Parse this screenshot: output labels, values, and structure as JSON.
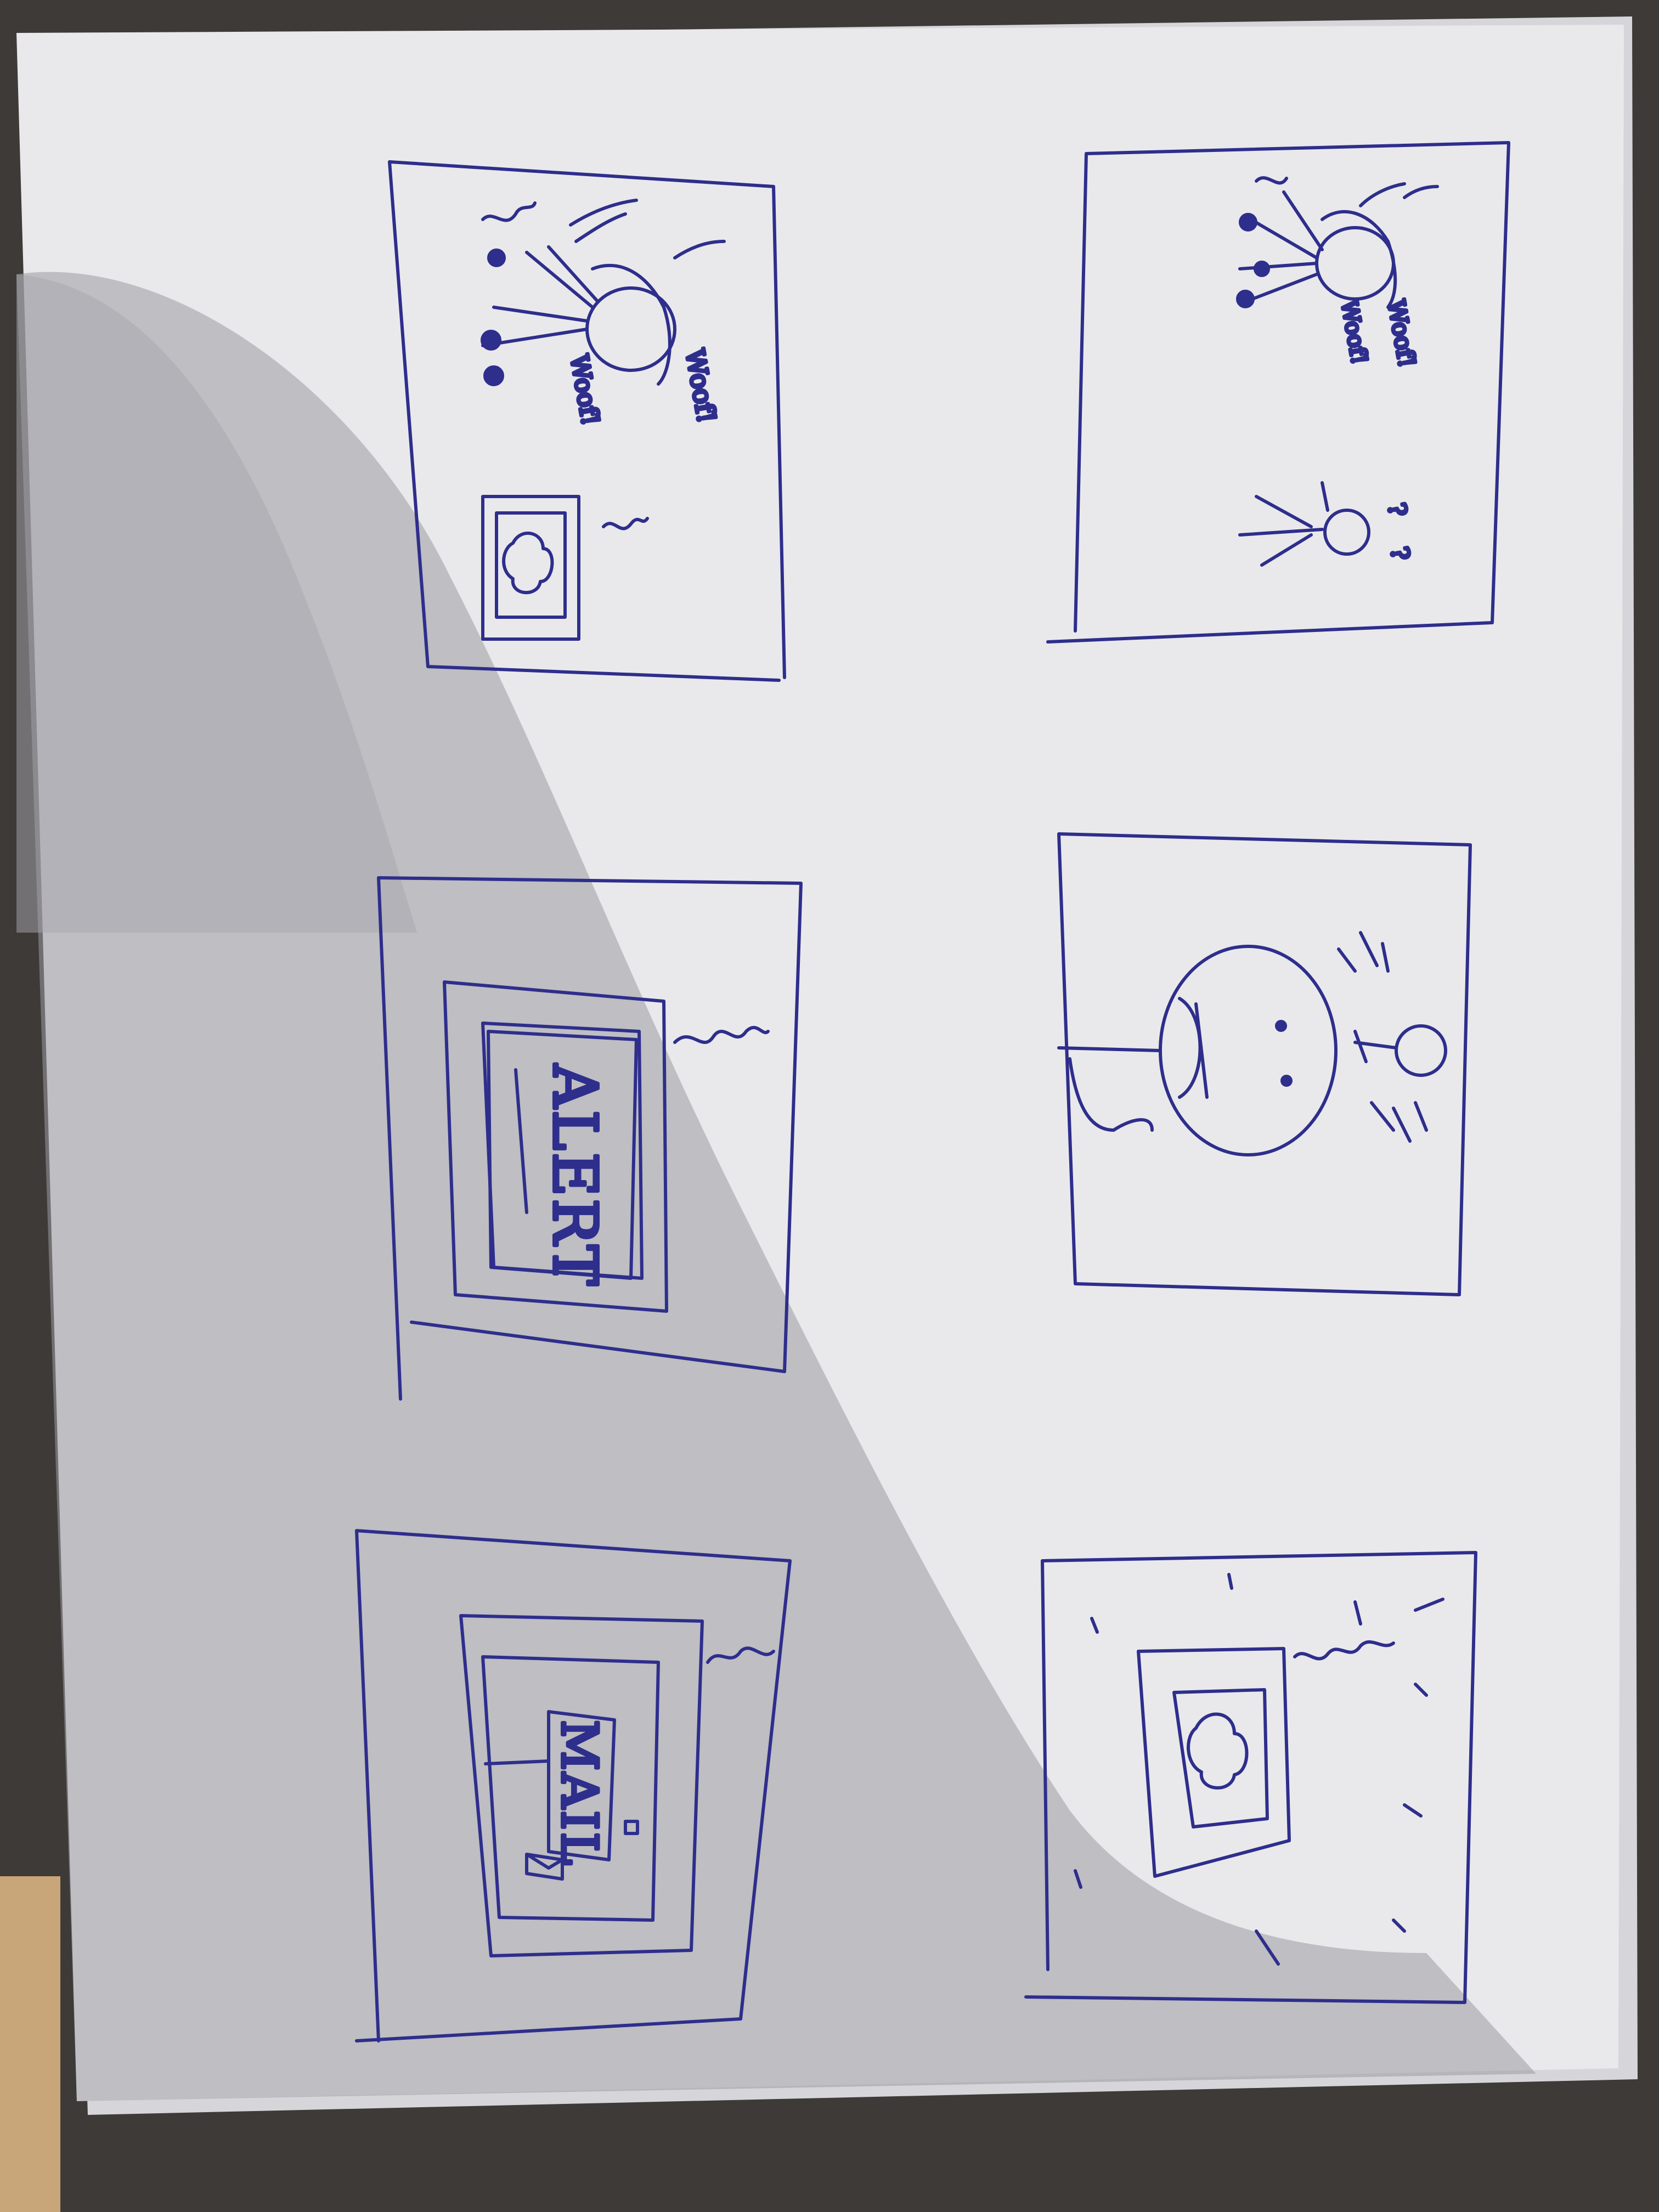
{
  "photo": {
    "colors": {
      "table": "#3e3a37",
      "table_wood": "#c9a57a",
      "paper": "#e9e9ec",
      "paper_back": "#d6d6da",
      "shadow": "#9a9aa3",
      "ink": "#2e2e8c"
    }
  },
  "panels": [
    {
      "id": "panel-1",
      "words": [
        "Woof!",
        "Woof!"
      ]
    },
    {
      "id": "panel-2",
      "words": [
        "Woof!",
        "Woof!",
        "?",
        "?"
      ]
    },
    {
      "id": "panel-3",
      "words": [
        "ALERT"
      ]
    },
    {
      "id": "panel-4",
      "words": []
    },
    {
      "id": "panel-5",
      "words": [
        "MAIL"
      ]
    },
    {
      "id": "panel-6",
      "words": []
    }
  ]
}
